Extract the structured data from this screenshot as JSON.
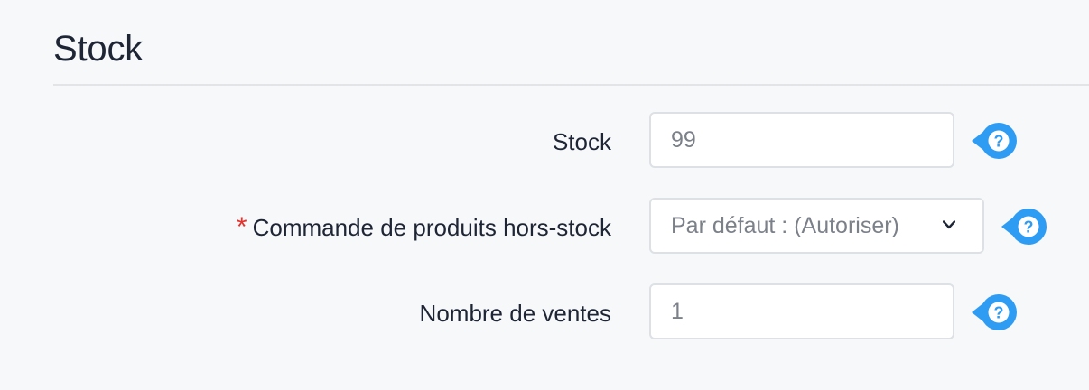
{
  "section": {
    "title": "Stock"
  },
  "fields": {
    "stock": {
      "label": "Stock",
      "value": "99"
    },
    "backorder": {
      "required_mark": "*",
      "label": "Commande de produits hors-stock",
      "selected": "Par défaut : (Autoriser)"
    },
    "sales": {
      "label": "Nombre de ventes",
      "value": "1"
    }
  },
  "icons": {
    "help": "question-mark-circle",
    "dropdown": "chevron-down"
  },
  "colors": {
    "accent": "#2f9cf4",
    "required": "#e5322d",
    "text": "#1e2535",
    "value_text": "#7b8089",
    "background": "#f7f8fa"
  }
}
